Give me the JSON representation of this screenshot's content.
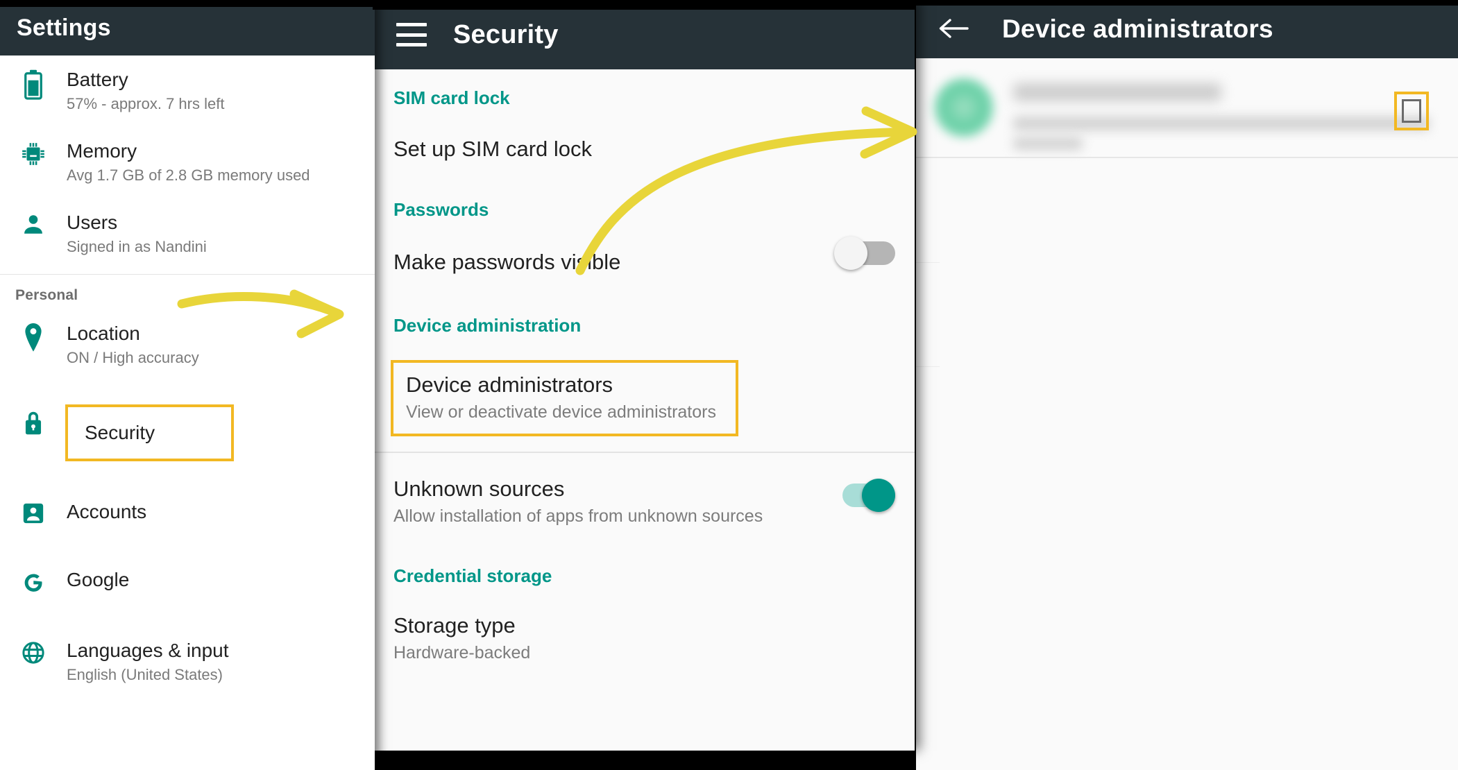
{
  "colors": {
    "appbar": "#263238",
    "accent_green": "#009688",
    "highlight_yellow": "#f2b823",
    "arrow_yellow": "#e8d53a"
  },
  "settings_panel": {
    "title": "Settings",
    "items": [
      {
        "icon": "battery-icon",
        "title": "Battery",
        "subtitle": "57% - approx. 7 hrs left"
      },
      {
        "icon": "memory-chip-icon",
        "title": "Memory",
        "subtitle": "Avg 1.7 GB of 2.8 GB memory used"
      },
      {
        "icon": "person-icon",
        "title": "Users",
        "subtitle": "Signed in as Nandini"
      }
    ],
    "section_header": "Personal",
    "personal_items": [
      {
        "icon": "location-pin-icon",
        "title": "Location",
        "subtitle": "ON / High accuracy",
        "highlighted": false
      },
      {
        "icon": "lock-icon",
        "title": "Security",
        "subtitle": "",
        "highlighted": true
      },
      {
        "icon": "account-box-icon",
        "title": "Accounts",
        "subtitle": "",
        "highlighted": false
      },
      {
        "icon": "google-g-icon",
        "title": "Google",
        "subtitle": "",
        "highlighted": false
      },
      {
        "icon": "globe-icon",
        "title": "Languages & input",
        "subtitle": "English (United States)",
        "highlighted": false
      }
    ]
  },
  "security_panel": {
    "title": "Security",
    "menu_icon": "hamburger-menu-icon",
    "categories": {
      "sim": "SIM card lock",
      "passwords": "Passwords",
      "device_admin": "Device administration",
      "credential": "Credential storage"
    },
    "rows": {
      "setup_sim": {
        "title": "Set up SIM card lock",
        "subtitle": ""
      },
      "make_passwords_visible": {
        "title": "Make passwords visible",
        "subtitle": "",
        "toggle": "off"
      },
      "device_administrators": {
        "title": "Device administrators",
        "subtitle": "View or deactivate device administrators",
        "highlighted": true
      },
      "unknown_sources": {
        "title": "Unknown sources",
        "subtitle": "Allow installation of apps from unknown sources",
        "toggle": "on"
      },
      "storage_type": {
        "title": "Storage type",
        "subtitle": "Hardware-backed"
      }
    }
  },
  "admins_panel": {
    "title": "Device administrators",
    "back_icon": "back-arrow-icon",
    "list_item": {
      "icon": "app-avatar-icon",
      "title": "",
      "subtitle": "",
      "checkbox": "unchecked",
      "checkbox_highlighted": true
    }
  },
  "annotations": {
    "arrow_1": "settings-security-to-device-administration",
    "arrow_2": "device-administrators-to-admin-list-item"
  }
}
